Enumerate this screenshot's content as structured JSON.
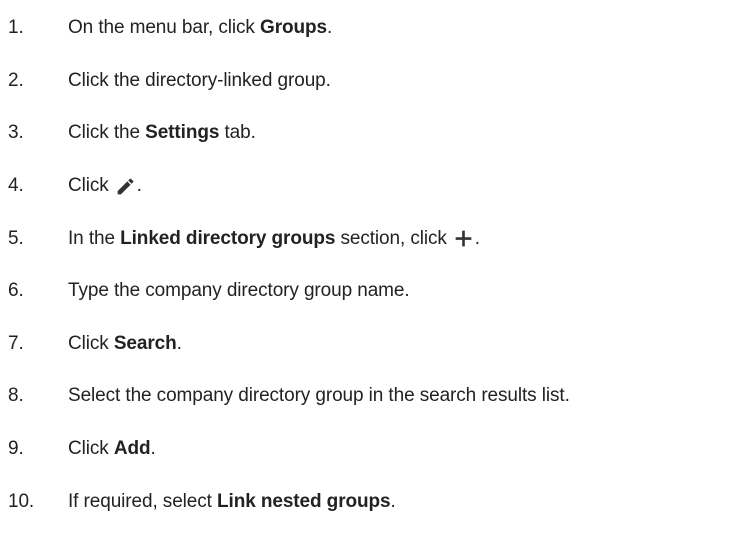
{
  "steps": [
    {
      "num": "1.",
      "a": "On the menu bar, click ",
      "b": "Groups",
      "c": "."
    },
    {
      "num": "2.",
      "a": "Click the directory-linked group."
    },
    {
      "num": "3.",
      "a": "Click the ",
      "b": "Settings",
      "c": " tab."
    },
    {
      "num": "4.",
      "a": "Click",
      "icon": "pencil-icon",
      "c": "."
    },
    {
      "num": "5.",
      "a": "In the ",
      "b": "Linked directory groups",
      "c": " section, click",
      "icon": "plus-icon",
      "d": "."
    },
    {
      "num": "6.",
      "a": "Type the company directory group name."
    },
    {
      "num": "7.",
      "a": "Click ",
      "b": "Search",
      "c": "."
    },
    {
      "num": "8.",
      "a": "Select the company directory group in the search results list."
    },
    {
      "num": "9.",
      "a": "Click ",
      "b": "Add",
      "c": "."
    },
    {
      "num": "10.",
      "a": "If required, select ",
      "b": "Link nested groups",
      "c": "."
    }
  ],
  "colors": {
    "text": "#222222",
    "icon": "#333333"
  }
}
